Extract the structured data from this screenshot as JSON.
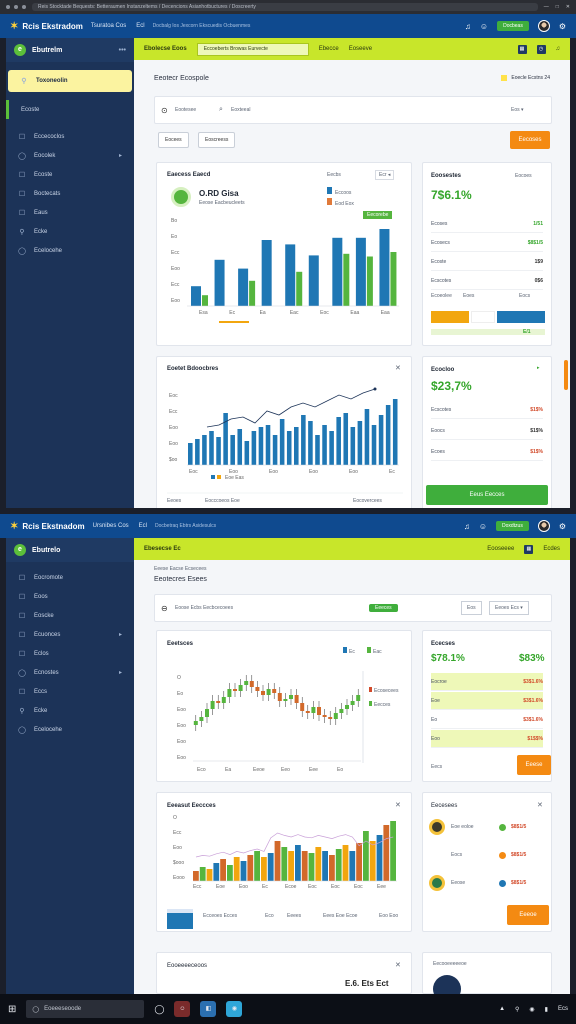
{
  "browser": {
    "url": "Reis Stocktade Bequests: Betteraumen Instanzeltems / Decencions Asianhotbuctures / Doscreerty",
    "controls": [
      "—",
      "□",
      "✕"
    ]
  },
  "topbar": {
    "logo": "Rcis Ekstradom",
    "nav": [
      "Tsuratoa Cos",
      "Ecl"
    ],
    "crumb": "Docbalg Ios Jexcorn Ekscuedis Ocbuenmes",
    "green_btn": "Docbeas",
    "logo2": "Rcis Ekstnadom",
    "nav2": [
      "Ursnibes Cos",
      "Ecl"
    ],
    "crumb2": "Docbetraq Ebtrs Asidesulcs",
    "green_btn2": "Doxdtzus"
  },
  "sidebar": {
    "title": "Ebutrelm",
    "active_label": "Toxoneolin",
    "selected_label": "Ecoste",
    "items": [
      {
        "icon": "☐",
        "label": "Eccecoclos"
      },
      {
        "icon": "◯",
        "label": "Eocolek",
        "caret": "▸"
      },
      {
        "icon": "☐",
        "label": "Ecoste"
      },
      {
        "icon": "☐",
        "label": "Boctecats"
      },
      {
        "icon": "☐",
        "label": "Eaus"
      },
      {
        "icon": "⚲",
        "label": "Ecke"
      },
      {
        "icon": "◯",
        "label": "Ecelocehe"
      }
    ],
    "title2": "Ebutrelo",
    "items2": [
      {
        "icon": "☐",
        "label": "Eocromote"
      },
      {
        "icon": "☐",
        "label": "Eoos"
      },
      {
        "icon": "☐",
        "label": "Eoscke"
      },
      {
        "icon": "☐",
        "label": "Ecuonces",
        "caret": "▸"
      },
      {
        "icon": "☐",
        "label": "Eclos"
      },
      {
        "icon": "◯",
        "label": "Ecnostes",
        "caret": "▸"
      },
      {
        "icon": "☐",
        "label": "Eccs"
      },
      {
        "icon": "⚲",
        "label": "Ecke"
      },
      {
        "icon": "◯",
        "label": "Ecelocehe"
      }
    ]
  },
  "screen1": {
    "lime": {
      "title": "Ebolecse Eoos",
      "input": "Eccoeberts Browas Eurvecte",
      "right1": "Ebecce",
      "right2": "Eoseeve"
    },
    "page_heading": "Eeotecr Ecospole",
    "heading_right": "Eoecle Ecstns 24",
    "search_placeholder": "Eootesee",
    "filter_placeholder": "Eoxteeal",
    "filter_right": "Eos ▾",
    "btn1": "Eocees",
    "btn2": "Eoscreess",
    "orange_btn": "Eecoses",
    "chart1": {
      "title": "Eaecess Eaecd",
      "menu": "Eecbs",
      "chip": "Ecr ◂",
      "stat_value": "O.RD Gisa",
      "stat_sub": "Eeose Eacbeucleets",
      "legend": [
        "Eccoos",
        "Eod Eox"
      ],
      "badge": "Eecorebe",
      "yticks": [
        "Eoo",
        "Ecc",
        "Eoo",
        "Ecc",
        "Eo",
        "Bo"
      ],
      "xticks": [
        "Esa",
        "Ec",
        "Ea",
        "Eac",
        "Eoc",
        "Eaa",
        "Eaa"
      ]
    },
    "panel1": {
      "title": "Eoosestes",
      "menu": "Eocoes",
      "big": "7$6.1%",
      "rows": [
        {
          "label": "Ecoses",
          "value": "1/51"
        },
        {
          "label": "Ecosecs",
          "value": "$8$1/5"
        },
        {
          "label": "Ecoste",
          "value": "1$9"
        },
        {
          "label": "Ecscotes",
          "value": "0$6"
        }
      ],
      "mini": [
        "Ecoeolee",
        "Eoes",
        "Eocs"
      ],
      "bottom_val": "E/1"
    },
    "chart2": {
      "title": "Eoetet Bdoocbres",
      "yticks": [
        "$oo",
        "Eoo",
        "Eoo",
        "Ecc",
        "Eoc"
      ],
      "xticks": [
        "Eoc",
        "Eoo",
        "Eoo",
        "Eoo",
        "Eoo",
        "Ec"
      ],
      "legend": "Eoe Eas",
      "footer_left": "Eeoes",
      "footer_mid": "Eocccoeos Eoe",
      "footer_right": "Eocovercees"
    },
    "panel2": {
      "title": "Ecocloo",
      "big": "$23,7%",
      "rows": [
        {
          "label": "Ecscotes",
          "value": "$1$%"
        },
        {
          "label": "Eoocs",
          "value": "$1$%"
        },
        {
          "label": "Ecoes",
          "value": "$1$%"
        }
      ],
      "green_btn": "Eeus Eecces"
    },
    "series": {
      "bars_blue": [
        18,
        42,
        34,
        60,
        56,
        46,
        62,
        62,
        70
      ],
      "bars_green": [
        12,
        20,
        28,
        48,
        38,
        30,
        58,
        55,
        60
      ],
      "bars2": [
        22,
        26,
        30,
        34,
        28,
        52,
        30,
        36,
        24,
        34,
        38,
        40,
        30,
        46,
        34,
        38,
        50,
        44,
        30,
        40,
        34,
        48,
        52,
        38,
        44,
        56,
        40,
        50,
        60,
        66
      ],
      "line2": [
        38,
        40,
        46,
        48,
        42,
        54,
        50,
        58,
        62,
        58,
        64,
        70,
        66,
        72,
        76
      ]
    }
  },
  "screen2": {
    "lime": {
      "title": "Ebesecse Ec",
      "right1": "Eooseeee",
      "right2": "Ecdes"
    },
    "page_heading": "Eeotecres Esees",
    "sub_heading": "Eeese Eacse Ecsecees",
    "filter_text": "Eoose Ecbs Eecbcecoees",
    "green_chip": "Eeeces",
    "filter_btn": "Eos",
    "filter_select": "Eeoes Ecs ▾",
    "candle": {
      "title": "Eeetsces",
      "legend": [
        "Ec",
        "Eac"
      ],
      "yticks": [
        "Eoo",
        "Eoo",
        "Eoo",
        "Eoo",
        "Eo",
        "O"
      ],
      "xticks": [
        "Eco",
        "Ea",
        "Eeoe",
        "Eeo",
        "Eee",
        "Eo"
      ],
      "right_labels": [
        "Ecosecees",
        "Eecces"
      ],
      "closes": [
        40,
        44,
        52,
        60,
        58,
        64,
        72,
        70,
        76,
        80,
        74,
        70,
        66,
        72,
        68,
        60,
        62,
        66,
        58,
        50,
        48,
        54,
        46,
        44,
        42,
        48,
        52,
        56,
        60,
        66
      ]
    },
    "panel3": {
      "title": "Ececses",
      "big": "$78.1%",
      "big2": "$83%",
      "rows": [
        {
          "label": "Eocroe",
          "value": "$3$1.6%",
          "lime": true
        },
        {
          "label": "Eoe",
          "value": "$3$1.6%",
          "lime": true
        },
        {
          "label": "Eo",
          "value": "$3$1.6%",
          "lime": false
        },
        {
          "label": "Eoo",
          "value": "$1$$%",
          "lime": true
        }
      ],
      "bottom_label": "Eecs",
      "orange_btn": "Eeese"
    },
    "combo": {
      "title": "Eeeasut Eeccces",
      "yticks": [
        "Eooo",
        "$ooo",
        "Eoo",
        "Ecc",
        "O"
      ],
      "xticks": [
        "Ecc",
        "Eoe",
        "Eoo",
        "Ec",
        "Ecoe",
        "Eoc",
        "Eoc",
        "Eoc",
        "Eee"
      ],
      "footer": [
        "Ecceoes Ecces",
        "Eco",
        "Eeees",
        "Eees Eoe Ecoe",
        "Eoo Eoo"
      ],
      "bars": [
        10,
        14,
        12,
        18,
        22,
        16,
        24,
        20,
        26,
        30,
        24,
        28,
        40,
        34,
        30,
        36,
        30,
        28,
        34,
        30,
        26,
        32,
        36,
        30,
        38,
        50,
        40,
        46,
        56,
        60
      ]
    },
    "panel4": {
      "title": "Eecesees",
      "items": [
        {
          "label": "Eoe eoloe",
          "value": "$8$1/5"
        },
        {
          "label": "Eocs",
          "value": "$8$1/5"
        },
        {
          "label": "Eeose",
          "value": "$8$1/5"
        }
      ],
      "orange_btn": "Eeeoe"
    },
    "bottom_card": {
      "title": "Eooeeeeceoos",
      "values": "E.6. Ets Ect",
      "right_title": "Eecooeeeeeoe"
    }
  },
  "taskbar": {
    "search": "Eoeeeseoode",
    "time": "Ecs",
    "tray": [
      "▲",
      "⚲",
      "◉",
      "▮",
      "Ecs"
    ]
  },
  "colors": {
    "accent": "#c8e62a",
    "topbar": "#0f4a8f",
    "sidebar": "#1c3358",
    "blue": "#1f77b4",
    "green": "#55b53e",
    "orange": "#f48a12",
    "red": "#d24a2a"
  }
}
